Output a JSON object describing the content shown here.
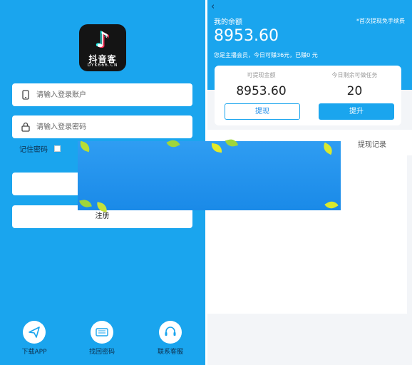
{
  "login": {
    "logo": {
      "name": "抖音客",
      "subtitle": "DYK666.CN"
    },
    "account_placeholder": "请输入登录账户",
    "password_placeholder": "请输入登录密码",
    "remember_label": "记住密码",
    "register_label": "注册",
    "footer": [
      {
        "label": "下载APP",
        "icon": "send-icon"
      },
      {
        "label": "找回密码",
        "icon": "keyboard-icon"
      },
      {
        "label": "联系客服",
        "icon": "headset-icon"
      }
    ]
  },
  "wallet": {
    "title": "我的余额",
    "note": "*首次提现免手续费",
    "balance": "8953.60",
    "subtitle": "您是主播会员，今日可赚36元，已赚0 元",
    "card": {
      "withdrawable_label": "可提现金额",
      "withdrawable_value": "8953.60",
      "tasks_label": "今日剩余可做任务",
      "tasks_value": "20",
      "withdraw_button": "提现",
      "upgrade_button": "提升"
    },
    "tabs": [
      "提现记录"
    ]
  },
  "colors": {
    "primary": "#1aa5ee",
    "text_dark": "#0d2d4a",
    "banner": "#2f9df2",
    "leaf": "#c6e13a"
  }
}
